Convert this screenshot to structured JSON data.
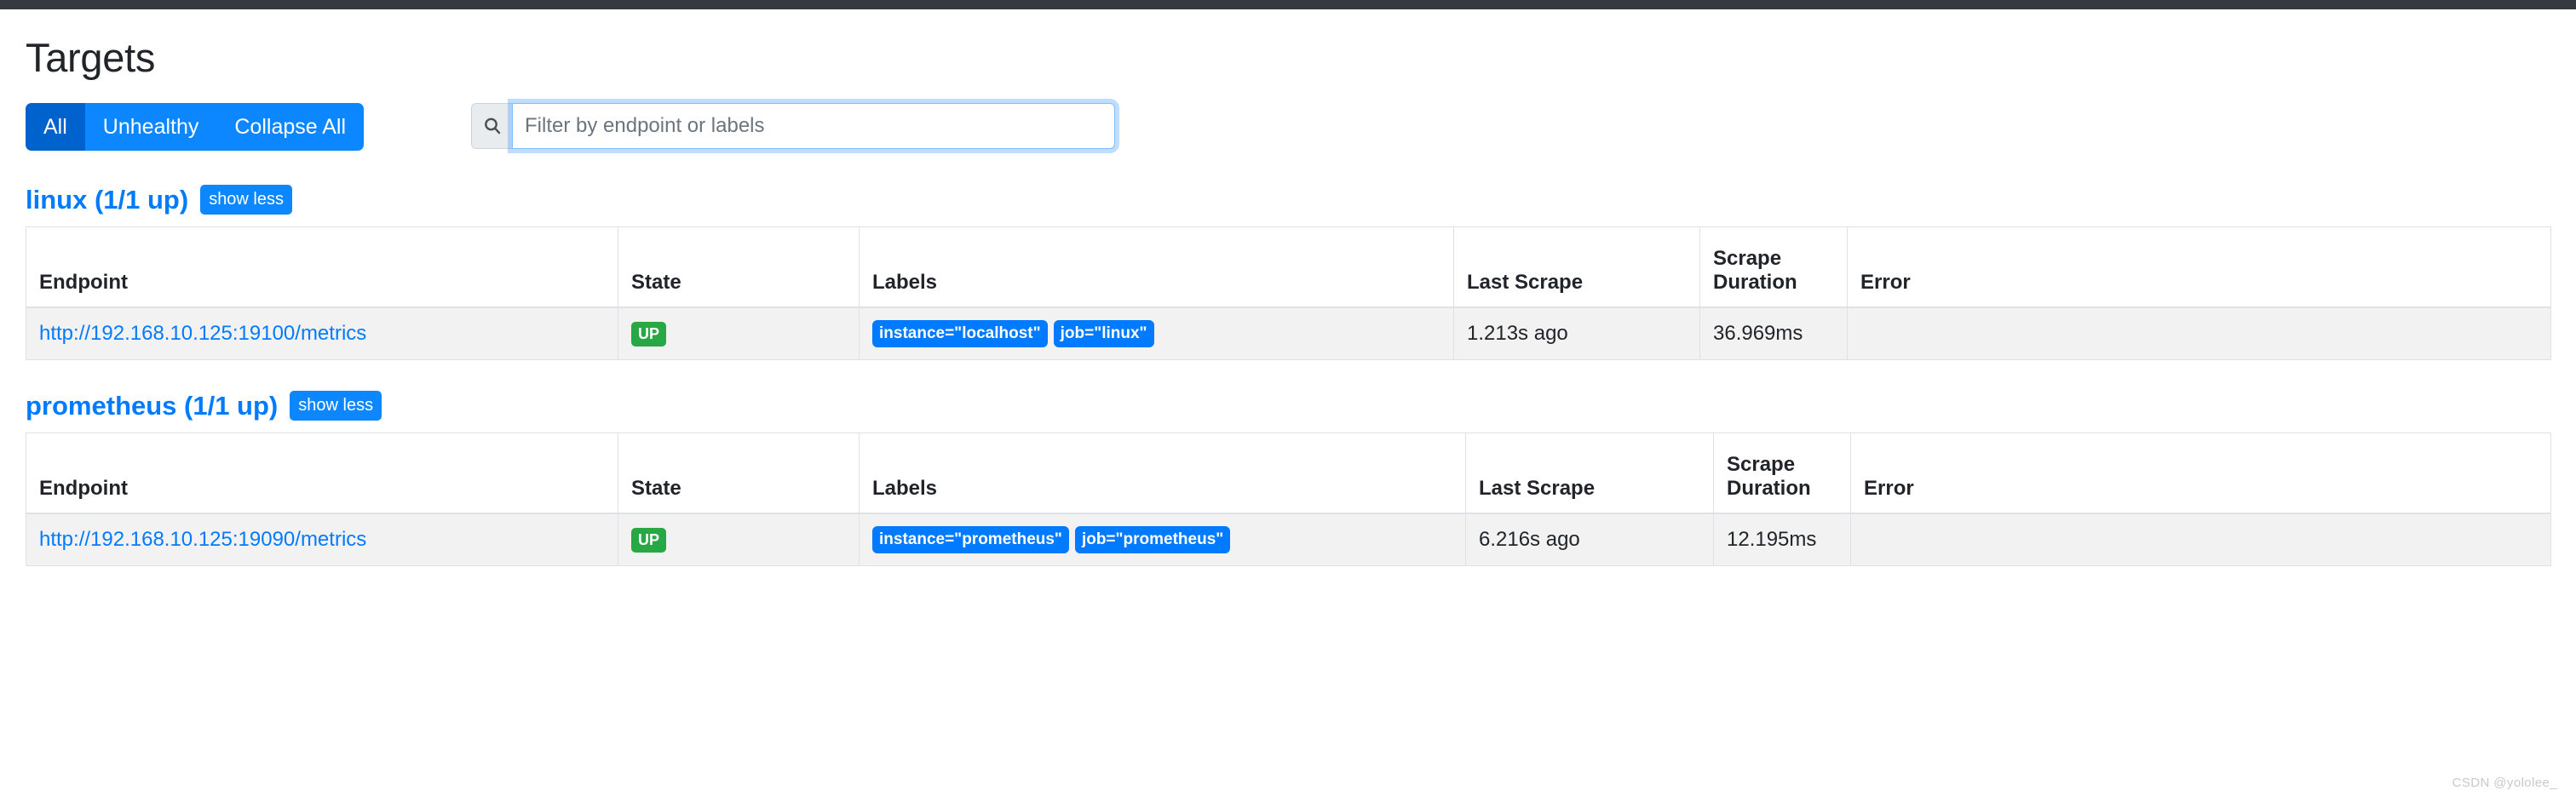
{
  "navbar": {
    "color": "#343a40"
  },
  "page": {
    "title": "Targets"
  },
  "filters": {
    "buttons": [
      {
        "label": "All",
        "active": true
      },
      {
        "label": "Unhealthy",
        "active": false
      },
      {
        "label": "Collapse All",
        "active": false
      }
    ],
    "search": {
      "icon": "search-icon",
      "placeholder": "Filter by endpoint or labels",
      "value": "",
      "focused": true
    }
  },
  "columns": [
    "Endpoint",
    "State",
    "Labels",
    "Last Scrape",
    "Scrape Duration",
    "Error"
  ],
  "jobs": [
    {
      "name": "linux",
      "title": "linux (1/1 up)",
      "up_count": "1/1 up",
      "toggle_label": "show less",
      "rows": [
        {
          "endpoint": "http://192.168.10.125:19100/metrics",
          "state": "UP",
          "labels": [
            "instance=\"localhost\"",
            "job=\"linux\""
          ],
          "last_scrape": "1.213s ago",
          "scrape_duration": "36.969ms",
          "error": ""
        }
      ]
    },
    {
      "name": "prometheus",
      "title": "prometheus (1/1 up)",
      "up_count": "1/1 up",
      "toggle_label": "show less",
      "rows": [
        {
          "endpoint": "http://192.168.10.125:19090/metrics",
          "state": "UP",
          "labels": [
            "instance=\"prometheus\"",
            "job=\"prometheus\""
          ],
          "last_scrape": "6.216s ago",
          "scrape_duration": "12.195ms",
          "error": ""
        }
      ]
    }
  ],
  "watermark": "CSDN @yololee_",
  "colors": {
    "primary": "#007bff",
    "primary_active": "#0062cc",
    "success": "#28a745",
    "navbar": "#343a40",
    "row_bg": "#f2f2f2",
    "border": "#dee2e6"
  }
}
